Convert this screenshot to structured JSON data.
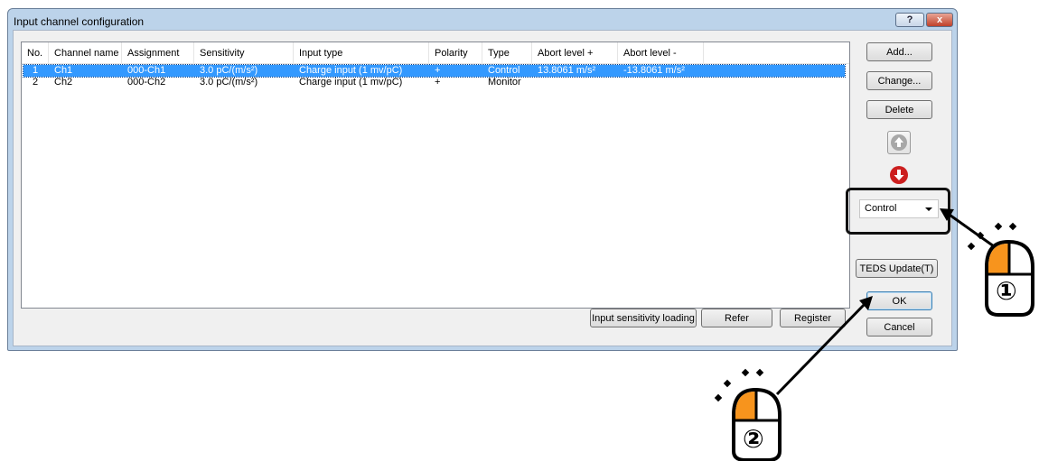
{
  "window": {
    "title": "Input channel configuration",
    "help_label": "?",
    "close_label": "x"
  },
  "table": {
    "headers": [
      "No.",
      "Channel name",
      "Assignment",
      "Sensitivity",
      "Input type",
      "Polarity",
      "Type",
      "Abort level +",
      "Abort level -"
    ],
    "rows": [
      {
        "no": "1",
        "name": "Ch1",
        "assignment": "000-Ch1",
        "sensitivity": "3.0 pC/(m/s²)",
        "input_type": "Charge input (1 mv/pC)",
        "polarity": "+",
        "type": "Control",
        "abort_plus": "13.8061 m/s²",
        "abort_minus": "-13.8061 m/s²",
        "selected": true
      },
      {
        "no": "2",
        "name": "Ch2",
        "assignment": "000-Ch2",
        "sensitivity": "3.0 pC/(m/s²)",
        "input_type": "Charge input (1 mv/pC)",
        "polarity": "+",
        "type": "Monitor",
        "abort_plus": "",
        "abort_minus": "",
        "selected": false
      }
    ]
  },
  "buttons": {
    "add": "Add...",
    "change": "Change...",
    "delete": "Delete",
    "teds_update": "TEDS Update(T)",
    "ok": "OK",
    "cancel": "Cancel",
    "input_sensitivity_loading": "Input sensitivity loading",
    "refer": "Refer",
    "register": "Register"
  },
  "type_combo": {
    "value": "Control"
  },
  "annotations": {
    "step1": "①",
    "step2": "②"
  },
  "colors": {
    "selection": "#3399ff",
    "mouse_button": "#f7941d",
    "down_arrow": "#cc1f1f",
    "up_arrow_disabled": "#a8a8a8"
  }
}
